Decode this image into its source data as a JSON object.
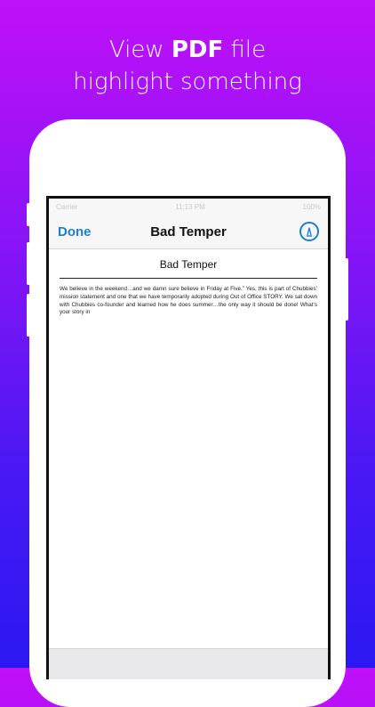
{
  "headline": {
    "line1_prefix": "View ",
    "line1_bold": "PDF",
    "line1_suffix": " file",
    "line2": "highlight something"
  },
  "status_bar": {
    "carrier": "Carrier",
    "time": "11:13 PM",
    "battery": "100%"
  },
  "nav": {
    "done_label": "Done",
    "title": "Bad Temper",
    "highlight_icon": "highlighter-icon"
  },
  "document": {
    "title": "Bad Temper",
    "body": "We believe in the weekend…and we damn sure believe in Friday at Five.”  Yes, this is part of Chubbies’ mission statement and one that we have temporarily adopted during Out of Office STORY. We sat down with Chubbies co-founder and learned how he does summer…the only way it should be done! What’s your story in"
  },
  "colors": {
    "accent": "#1a7fd6",
    "gradient_top": "#c010f8",
    "gradient_bottom": "#2a18f2"
  }
}
